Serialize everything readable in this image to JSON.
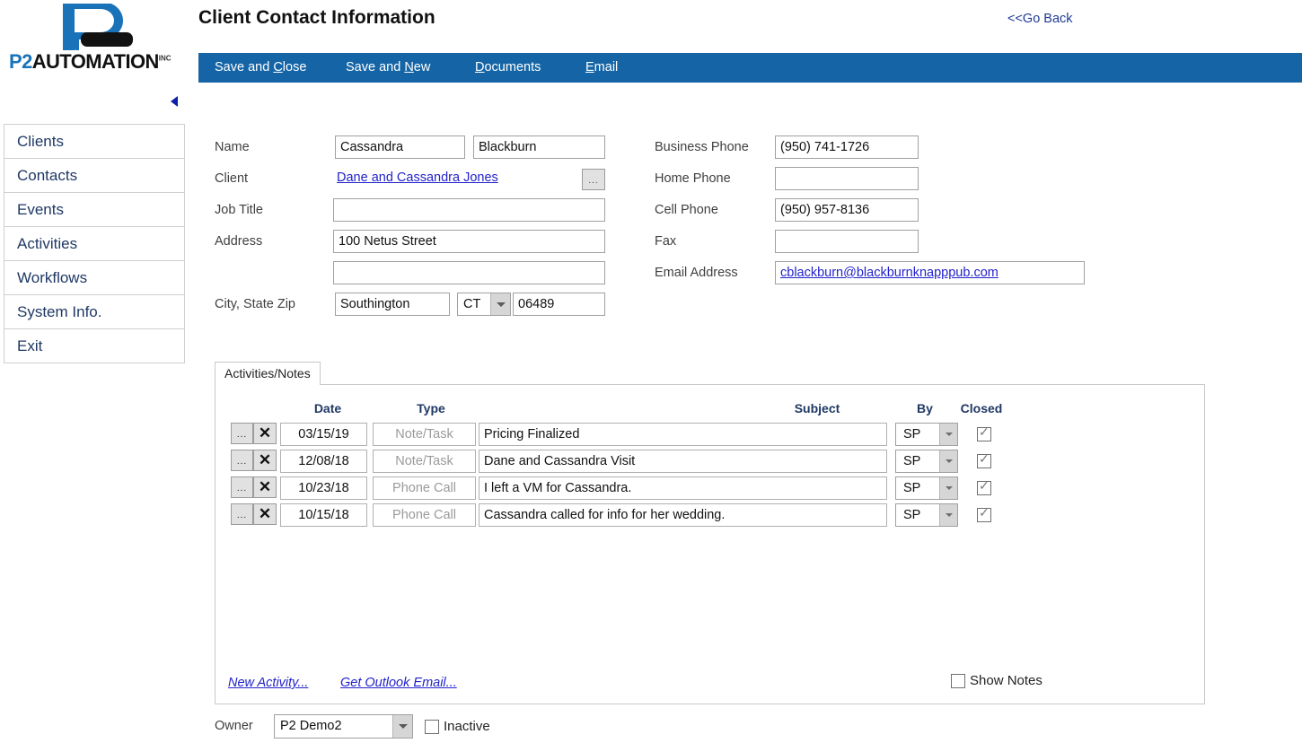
{
  "brand": {
    "logo_p2": "P2",
    "logo_automation": "AUTOMATION",
    "logo_suffix": "INC"
  },
  "header": {
    "title": "Client Contact Information",
    "go_back": "<<Go Back"
  },
  "menubar": {
    "items": [
      {
        "pre": "Save and ",
        "accel": "C",
        "post": "lose"
      },
      {
        "pre": "Save and ",
        "accel": "N",
        "post": "ew"
      },
      {
        "pre": "",
        "accel": "D",
        "post": "ocuments"
      },
      {
        "pre": "",
        "accel": "E",
        "post": "mail"
      }
    ]
  },
  "sidebar": {
    "items": [
      {
        "label": "Clients"
      },
      {
        "label": "Contacts"
      },
      {
        "label": "Events"
      },
      {
        "label": "Activities"
      },
      {
        "label": "Workflows"
      },
      {
        "label": "System Info."
      },
      {
        "label": "Exit"
      }
    ]
  },
  "form": {
    "left": {
      "name_label": "Name",
      "first_name": "Cassandra",
      "last_name": "Blackburn",
      "client_label": "Client",
      "client_value": "Dane and Cassandra Jones",
      "client_picker": "...",
      "job_title_label": "Job Title",
      "job_title": "",
      "address_label": "Address",
      "address1": "100 Netus Street",
      "address2": "",
      "citystatezip_label": "City, State Zip",
      "city": "Southington",
      "state": "CT",
      "zip": "06489"
    },
    "right": {
      "business_phone_label": "Business Phone",
      "business_phone": "(950) 741-1726",
      "home_phone_label": "Home Phone",
      "home_phone": "",
      "cell_phone_label": "Cell Phone",
      "cell_phone": "(950) 957-8136",
      "fax_label": "Fax",
      "fax": "",
      "email_label": "Email Address",
      "email": "cblackburn@blackburnknapppub.com"
    }
  },
  "activities": {
    "tab_label": "Activities/Notes",
    "columns": [
      "Date",
      "Type",
      "Subject",
      "By",
      "Closed"
    ],
    "row_buttons": {
      "edit": "...",
      "delete": "✕"
    },
    "rows": [
      {
        "date": "03/15/19",
        "type": "Note/Task",
        "subject": "Pricing Finalized",
        "by": "SP",
        "closed": true
      },
      {
        "date": "12/08/18",
        "type": "Note/Task",
        "subject": "Dane and Cassandra Visit",
        "by": "SP",
        "closed": true
      },
      {
        "date": "10/23/18",
        "type": "Phone Call",
        "subject": "I left a VM for Cassandra.",
        "by": "SP",
        "closed": true
      },
      {
        "date": "10/15/18",
        "type": "Phone Call",
        "subject": "Cassandra called for info for her wedding.",
        "by": "SP",
        "closed": true
      }
    ],
    "new_activity_link": "New Activity...",
    "get_outlook_link": "Get Outlook Email...",
    "show_notes_label": "Show Notes",
    "show_notes_checked": false
  },
  "footer": {
    "owner_label": "Owner",
    "owner_value": "P2 Demo2",
    "inactive_label": "Inactive",
    "inactive_checked": false
  },
  "colors": {
    "menubar_blue": "#1565a6",
    "brand_blue": "#1a72b8",
    "navy_text": "#1f3864",
    "link_blue": "#2222cc"
  }
}
